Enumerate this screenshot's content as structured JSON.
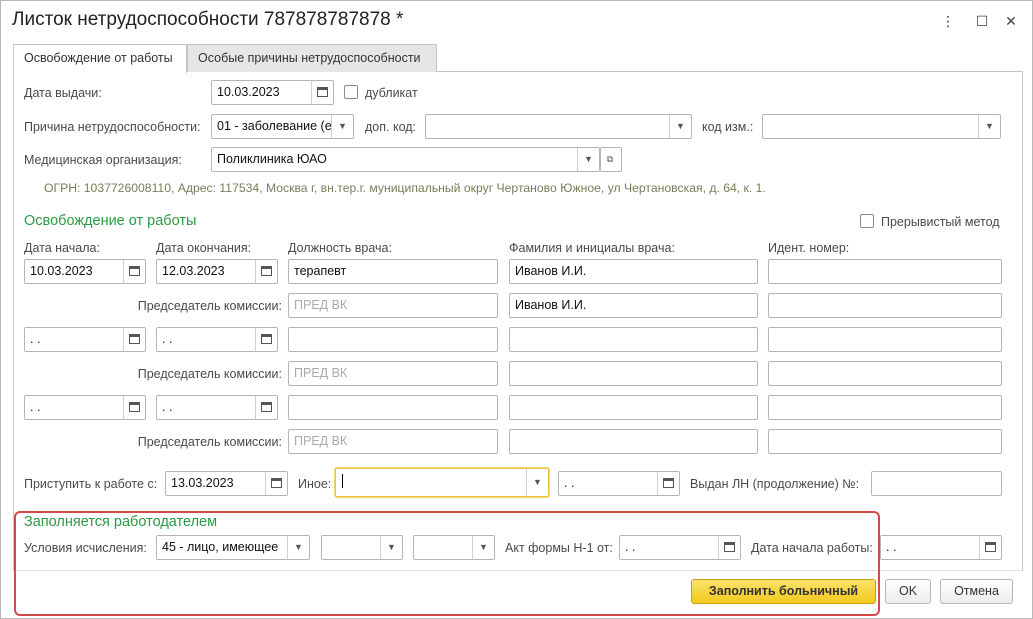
{
  "window": {
    "title": "Листок нетрудоспособности 787878787878 *",
    "more_glyph": "⋮",
    "maximize_glyph": "☐",
    "close_glyph": "✕"
  },
  "tabs": [
    {
      "label": "Освобождение от работы",
      "active": true
    },
    {
      "label": "Особые причины нетрудоспособности",
      "active": false
    }
  ],
  "issue": {
    "date_label": "Дата выдачи:",
    "date_value": "10.03.2023",
    "duplicate_label": "дубликат",
    "duplicate_checked": false
  },
  "cause": {
    "label": "Причина нетрудоспособности:",
    "value": "01 - заболевание (е",
    "extra_code_label": "доп. код:",
    "extra_code_value": "",
    "change_code_label": "код изм.:",
    "change_code_value": ""
  },
  "medorg": {
    "label": "Медицинская организация:",
    "value": "Поликлиника ЮАО",
    "info": "ОГРН: 1037726008110, Адрес: 117534, Москва г, вн.тер.г. муниципальный округ Чертаново Южное, ул Чертановская, д. 64, к. 1."
  },
  "release": {
    "section_title": "Освобождение от работы",
    "interrupted_label": "Прерывистый метод",
    "interrupted_checked": false,
    "col_start": "Дата начала:",
    "col_end": "Дата окончания:",
    "col_position": "Должность врача:",
    "col_doctor": "Фамилия и инициалы врача:",
    "col_id": "Идент.  номер:",
    "chairman_label": "Председатель комиссии:",
    "chairman_placeholder": "ПРЕД ВК",
    "empty_date": " .  .",
    "rows": [
      {
        "start": "10.03.2023",
        "end": "12.03.2023",
        "position": "терапевт",
        "doctor": "Иванов И.И.",
        "id": "",
        "chairman_doctor": "Иванов И.И."
      },
      {
        "start": " .  .",
        "end": " .  .",
        "position": "",
        "doctor": "",
        "id": "",
        "chairman_doctor": ""
      },
      {
        "start": " .  .",
        "end": " .  .",
        "position": "",
        "doctor": "",
        "id": "",
        "chairman_doctor": ""
      }
    ]
  },
  "return": {
    "label": "Приступить к работе с:",
    "value": "13.03.2023",
    "other_label": "Иное:",
    "other_value": "",
    "other_date": " .  .",
    "continued_label": "Выдан ЛН (продолжение) №:",
    "continued_value": ""
  },
  "employer": {
    "section_title": "Заполняется работодателем",
    "conditions_label": "Условия исчисления:",
    "conditions_value": "45 - лицо, имеющее ",
    "cond2_value": "",
    "cond3_value": "",
    "act_label": "Акт формы Н-1 от:",
    "act_value": " .  .",
    "work_start_label": "Дата начала работы:",
    "work_start_value": " .  ."
  },
  "footer": {
    "fill_label": "Заполнить больничный",
    "ok_label": "OK",
    "cancel_label": "Отмена"
  },
  "colors": {
    "accent_green": "#2b9a43",
    "primary_button": "#f2c91c",
    "highlight_border": "#d24a4a",
    "focus_border": "#f0c33c"
  }
}
